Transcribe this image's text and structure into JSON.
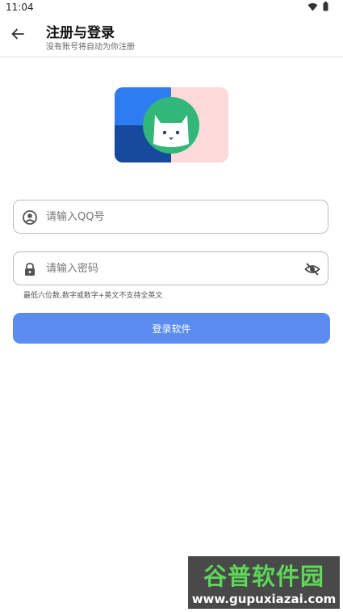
{
  "status_bar": {
    "time": "11:04",
    "icons": [
      "wifi-icon",
      "battery-icon"
    ]
  },
  "header": {
    "title": "注册与登录",
    "subtitle": "没有账号将自动为你注册",
    "back_icon": "arrow-left-icon"
  },
  "logo": {
    "icon": "cat-face-logo",
    "colors": {
      "top_left": "#2f7cf2",
      "bottom_left": "#164a9d",
      "right": "#fdd9d9",
      "circle": "#33b67a"
    }
  },
  "form": {
    "qq_field": {
      "value": "",
      "placeholder": "请输入QQ号",
      "icon": "account-circle-icon"
    },
    "password_field": {
      "value": "",
      "placeholder": "请输入密码",
      "icon": "lock-icon",
      "toggle_icon": "eye-off-icon"
    },
    "password_hint": "最低六位数,数字或数字+英文不支持全英文",
    "submit_label": "登录软件",
    "submit_color": "#5b8cf0"
  },
  "watermark": {
    "title": "谷普软件园",
    "url": "www.gupuxiazai.com"
  }
}
